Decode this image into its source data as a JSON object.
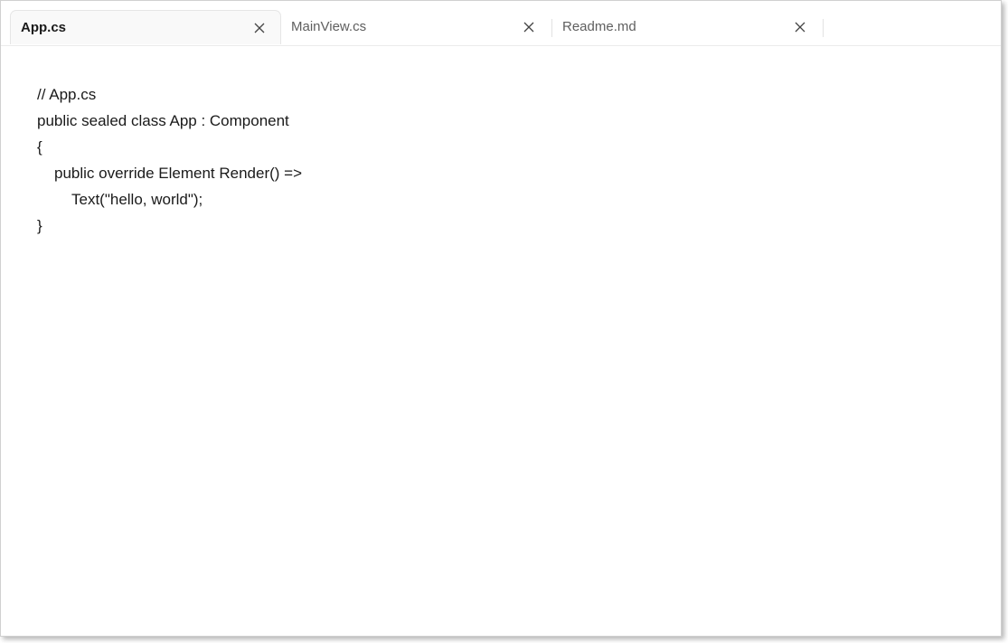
{
  "tabs": [
    {
      "label": "App.cs",
      "active": true,
      "close_icon": "close-icon"
    },
    {
      "label": "MainView.cs",
      "active": false,
      "close_icon": "close-icon"
    },
    {
      "label": "Readme.md",
      "active": false,
      "close_icon": "close-icon"
    }
  ],
  "editor": {
    "lines": [
      {
        "text": "// App.cs",
        "indent": 0
      },
      {
        "text": "public sealed class App : Component",
        "indent": 0
      },
      {
        "text": "{",
        "indent": 0
      },
      {
        "text": "public override Element Render() =>",
        "indent": 1
      },
      {
        "text": "Text(\"hello, world\");",
        "indent": 2
      },
      {
        "text": "}",
        "indent": 0
      }
    ]
  },
  "colors": {
    "text": "#1a1a1a",
    "inactive_tab_text": "#5f5f5f",
    "active_tab_bg": "#f9f9f9"
  }
}
